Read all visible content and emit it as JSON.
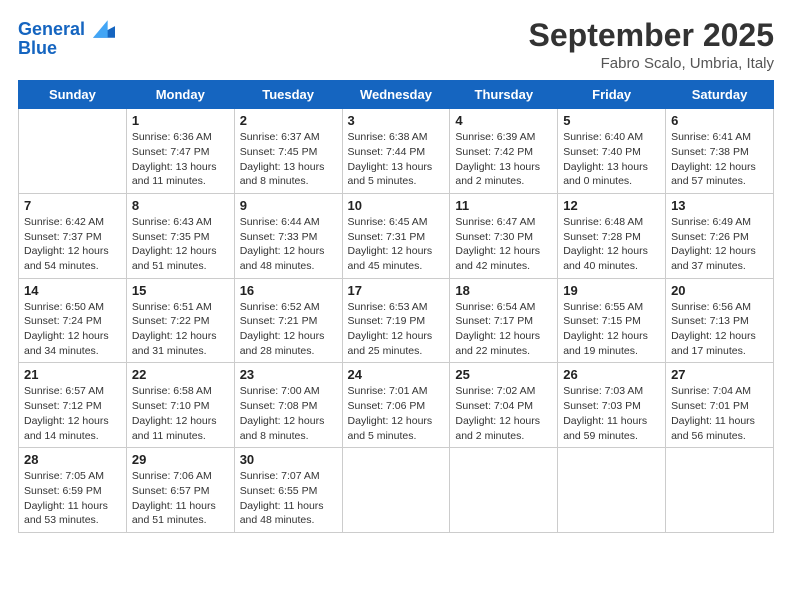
{
  "header": {
    "logo_line1": "General",
    "logo_line2": "Blue",
    "month": "September 2025",
    "location": "Fabro Scalo, Umbria, Italy"
  },
  "days_of_week": [
    "Sunday",
    "Monday",
    "Tuesday",
    "Wednesday",
    "Thursday",
    "Friday",
    "Saturday"
  ],
  "weeks": [
    [
      {
        "day": "",
        "info": ""
      },
      {
        "day": "1",
        "info": "Sunrise: 6:36 AM\nSunset: 7:47 PM\nDaylight: 13 hours\nand 11 minutes."
      },
      {
        "day": "2",
        "info": "Sunrise: 6:37 AM\nSunset: 7:45 PM\nDaylight: 13 hours\nand 8 minutes."
      },
      {
        "day": "3",
        "info": "Sunrise: 6:38 AM\nSunset: 7:44 PM\nDaylight: 13 hours\nand 5 minutes."
      },
      {
        "day": "4",
        "info": "Sunrise: 6:39 AM\nSunset: 7:42 PM\nDaylight: 13 hours\nand 2 minutes."
      },
      {
        "day": "5",
        "info": "Sunrise: 6:40 AM\nSunset: 7:40 PM\nDaylight: 13 hours\nand 0 minutes."
      },
      {
        "day": "6",
        "info": "Sunrise: 6:41 AM\nSunset: 7:38 PM\nDaylight: 12 hours\nand 57 minutes."
      }
    ],
    [
      {
        "day": "7",
        "info": "Sunrise: 6:42 AM\nSunset: 7:37 PM\nDaylight: 12 hours\nand 54 minutes."
      },
      {
        "day": "8",
        "info": "Sunrise: 6:43 AM\nSunset: 7:35 PM\nDaylight: 12 hours\nand 51 minutes."
      },
      {
        "day": "9",
        "info": "Sunrise: 6:44 AM\nSunset: 7:33 PM\nDaylight: 12 hours\nand 48 minutes."
      },
      {
        "day": "10",
        "info": "Sunrise: 6:45 AM\nSunset: 7:31 PM\nDaylight: 12 hours\nand 45 minutes."
      },
      {
        "day": "11",
        "info": "Sunrise: 6:47 AM\nSunset: 7:30 PM\nDaylight: 12 hours\nand 42 minutes."
      },
      {
        "day": "12",
        "info": "Sunrise: 6:48 AM\nSunset: 7:28 PM\nDaylight: 12 hours\nand 40 minutes."
      },
      {
        "day": "13",
        "info": "Sunrise: 6:49 AM\nSunset: 7:26 PM\nDaylight: 12 hours\nand 37 minutes."
      }
    ],
    [
      {
        "day": "14",
        "info": "Sunrise: 6:50 AM\nSunset: 7:24 PM\nDaylight: 12 hours\nand 34 minutes."
      },
      {
        "day": "15",
        "info": "Sunrise: 6:51 AM\nSunset: 7:22 PM\nDaylight: 12 hours\nand 31 minutes."
      },
      {
        "day": "16",
        "info": "Sunrise: 6:52 AM\nSunset: 7:21 PM\nDaylight: 12 hours\nand 28 minutes."
      },
      {
        "day": "17",
        "info": "Sunrise: 6:53 AM\nSunset: 7:19 PM\nDaylight: 12 hours\nand 25 minutes."
      },
      {
        "day": "18",
        "info": "Sunrise: 6:54 AM\nSunset: 7:17 PM\nDaylight: 12 hours\nand 22 minutes."
      },
      {
        "day": "19",
        "info": "Sunrise: 6:55 AM\nSunset: 7:15 PM\nDaylight: 12 hours\nand 19 minutes."
      },
      {
        "day": "20",
        "info": "Sunrise: 6:56 AM\nSunset: 7:13 PM\nDaylight: 12 hours\nand 17 minutes."
      }
    ],
    [
      {
        "day": "21",
        "info": "Sunrise: 6:57 AM\nSunset: 7:12 PM\nDaylight: 12 hours\nand 14 minutes."
      },
      {
        "day": "22",
        "info": "Sunrise: 6:58 AM\nSunset: 7:10 PM\nDaylight: 12 hours\nand 11 minutes."
      },
      {
        "day": "23",
        "info": "Sunrise: 7:00 AM\nSunset: 7:08 PM\nDaylight: 12 hours\nand 8 minutes."
      },
      {
        "day": "24",
        "info": "Sunrise: 7:01 AM\nSunset: 7:06 PM\nDaylight: 12 hours\nand 5 minutes."
      },
      {
        "day": "25",
        "info": "Sunrise: 7:02 AM\nSunset: 7:04 PM\nDaylight: 12 hours\nand 2 minutes."
      },
      {
        "day": "26",
        "info": "Sunrise: 7:03 AM\nSunset: 7:03 PM\nDaylight: 11 hours\nand 59 minutes."
      },
      {
        "day": "27",
        "info": "Sunrise: 7:04 AM\nSunset: 7:01 PM\nDaylight: 11 hours\nand 56 minutes."
      }
    ],
    [
      {
        "day": "28",
        "info": "Sunrise: 7:05 AM\nSunset: 6:59 PM\nDaylight: 11 hours\nand 53 minutes."
      },
      {
        "day": "29",
        "info": "Sunrise: 7:06 AM\nSunset: 6:57 PM\nDaylight: 11 hours\nand 51 minutes."
      },
      {
        "day": "30",
        "info": "Sunrise: 7:07 AM\nSunset: 6:55 PM\nDaylight: 11 hours\nand 48 minutes."
      },
      {
        "day": "",
        "info": ""
      },
      {
        "day": "",
        "info": ""
      },
      {
        "day": "",
        "info": ""
      },
      {
        "day": "",
        "info": ""
      }
    ]
  ]
}
